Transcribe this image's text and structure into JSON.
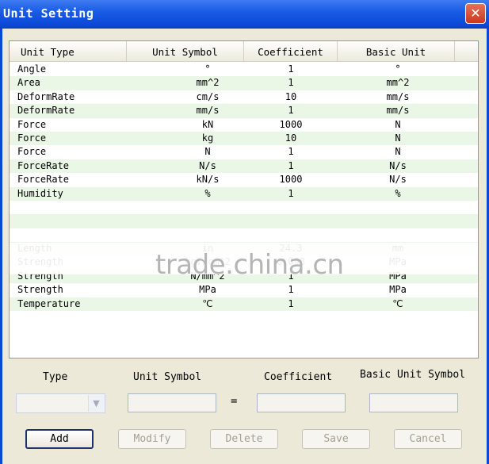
{
  "window": {
    "title": "Unit Setting"
  },
  "table": {
    "headers": [
      "Unit Type",
      "Unit Symbol",
      "Coefficient",
      "Basic Unit"
    ],
    "rows": [
      [
        "Angle",
        "°",
        "1",
        "°"
      ],
      [
        "Area",
        "mm^2",
        "1",
        "mm^2"
      ],
      [
        "DeformRate",
        "cm/s",
        "10",
        "mm/s"
      ],
      [
        "DeformRate",
        "mm/s",
        "1",
        "mm/s"
      ],
      [
        "Force",
        "kN",
        "1000",
        "N"
      ],
      [
        "Force",
        "kg",
        "10",
        "N"
      ],
      [
        "Force",
        "N",
        "1",
        "N"
      ],
      [
        "ForceRate",
        "N/s",
        "1",
        "N/s"
      ],
      [
        "ForceRate",
        "kN/s",
        "1000",
        "N/s"
      ],
      [
        "Humidity",
        "%",
        "1",
        "%"
      ],
      [
        "",
        "",
        "",
        ""
      ],
      [
        "",
        "",
        "",
        ""
      ],
      [
        "",
        "",
        "",
        ""
      ],
      [
        "Length",
        "in",
        "24.3",
        "mm"
      ],
      [
        "Strength",
        "kgf/cm^2",
        "0.098",
        "MPa"
      ],
      [
        "Strength",
        "N/mm^2",
        "1",
        "MPa"
      ],
      [
        "Strength",
        "MPa",
        "1",
        "MPa"
      ],
      [
        "Temperature",
        "℃",
        "1",
        "℃"
      ]
    ]
  },
  "watermark": "trade.china.cn",
  "form": {
    "type_label": "Type",
    "unit_symbol_label": "Unit Symbol",
    "coefficient_label": "Coefficient",
    "basic_unit_symbol_label": "Basic Unit Symbol",
    "equals": "=",
    "type_value": "",
    "unit_symbol_value": "",
    "coefficient_value": "",
    "basic_unit_symbol_value": ""
  },
  "buttons": {
    "add": "Add",
    "modify": "Modify",
    "delete": "Delete",
    "save": "Save",
    "cancel": "Cancel"
  },
  "icons": {
    "close": "close-icon",
    "dropdown": "chevron-down-icon"
  },
  "colors": {
    "titlebar": "#0a47d4",
    "row_alt": "#eaf7e6",
    "close": "#c9381d"
  }
}
